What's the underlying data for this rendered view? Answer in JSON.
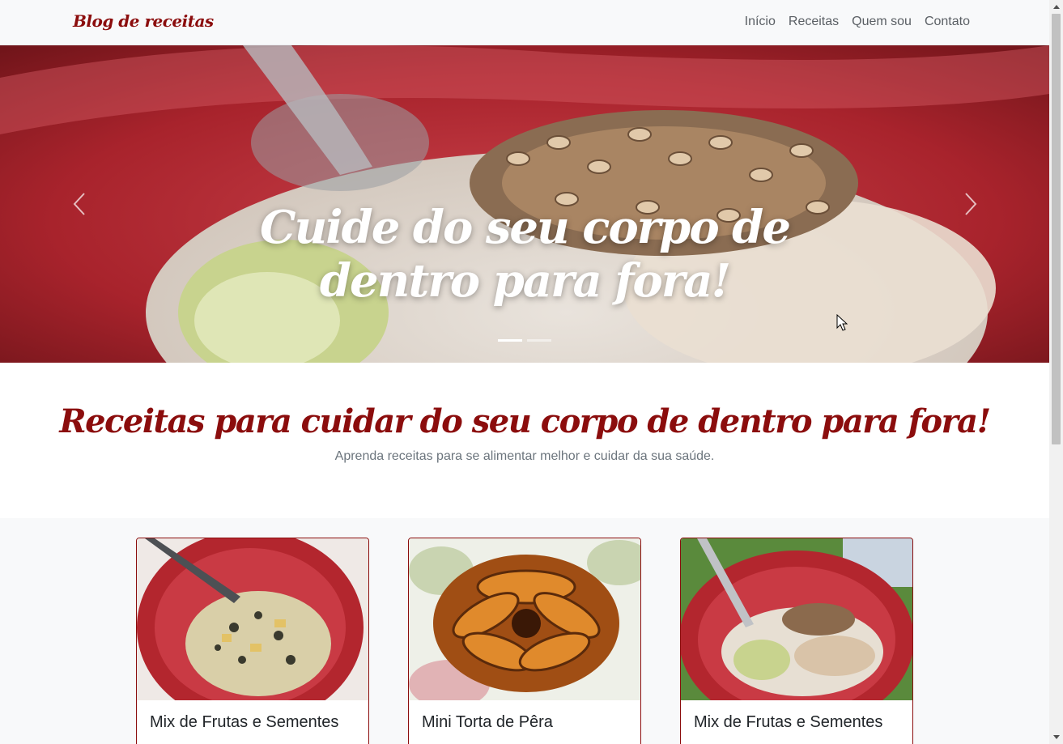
{
  "navbar": {
    "brand": "Blog de receitas",
    "links": [
      "Início",
      "Receitas",
      "Quem sou",
      "Contato"
    ]
  },
  "hero": {
    "caption": "Cuide do seu corpo de dentro para fora!",
    "indicator_count": 2,
    "active_indicator": 1
  },
  "intro": {
    "title": "Receitas para cuidar do seu corpo de dentro para fora!",
    "subtitle": "Aprenda receitas para se alimentar melhor e cuidar da sua saúde."
  },
  "cards": [
    {
      "title": "Mix de Frutas e Sementes",
      "image_icon": "fruit-seed-bowl-photo"
    },
    {
      "title": "Mini Torta de Pêra",
      "image_icon": "pear-tart-photo"
    },
    {
      "title": "Mix de Frutas e Sementes",
      "image_icon": "fruit-seed-bowl-photo"
    }
  ],
  "colors": {
    "brand": "#8b0d0d",
    "navbar_bg": "#f8f9fa",
    "bowl_red": "#b3262e",
    "muted_text": "#6c757d"
  }
}
